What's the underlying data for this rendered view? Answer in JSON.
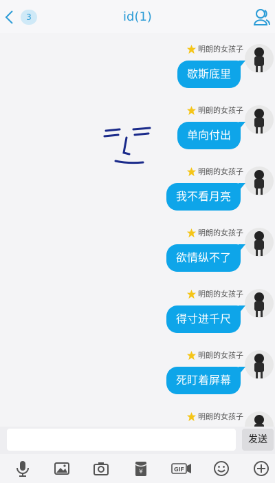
{
  "header": {
    "title": "id(1)",
    "unread_count": "3"
  },
  "sender_name": "明朗的女孩子",
  "messages": [
    {
      "text": "歇斯底里"
    },
    {
      "text": "单向付出"
    },
    {
      "text": "我不看月亮"
    },
    {
      "text": "欲情纵不了"
    },
    {
      "text": "得寸进千尺"
    },
    {
      "text": "死盯着屏幕"
    },
    {
      "text": ""
    }
  ],
  "input": {
    "value": "",
    "placeholder": ""
  },
  "send_label": "发送",
  "toolbar_icons": [
    "microphone-icon",
    "image-icon",
    "camera-icon",
    "red-packet-icon",
    "gif-icon",
    "emoji-icon",
    "plus-icon"
  ],
  "colors": {
    "accent": "#2a9bd6",
    "bubble": "#0ea5e9",
    "star": "#f5c518"
  }
}
